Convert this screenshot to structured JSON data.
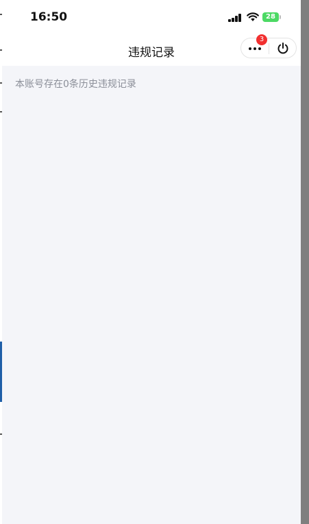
{
  "status": {
    "time": "16:50",
    "battery": "28"
  },
  "nav": {
    "title": "违规记录",
    "more_icon": "more-dots-icon",
    "badge_count": "3",
    "power_icon": "power-icon"
  },
  "content": {
    "message": "本账号存在0条历史违规记录"
  },
  "colors": {
    "badge": "#f23030",
    "battery": "#4cd964",
    "background": "#f4f5f9"
  }
}
